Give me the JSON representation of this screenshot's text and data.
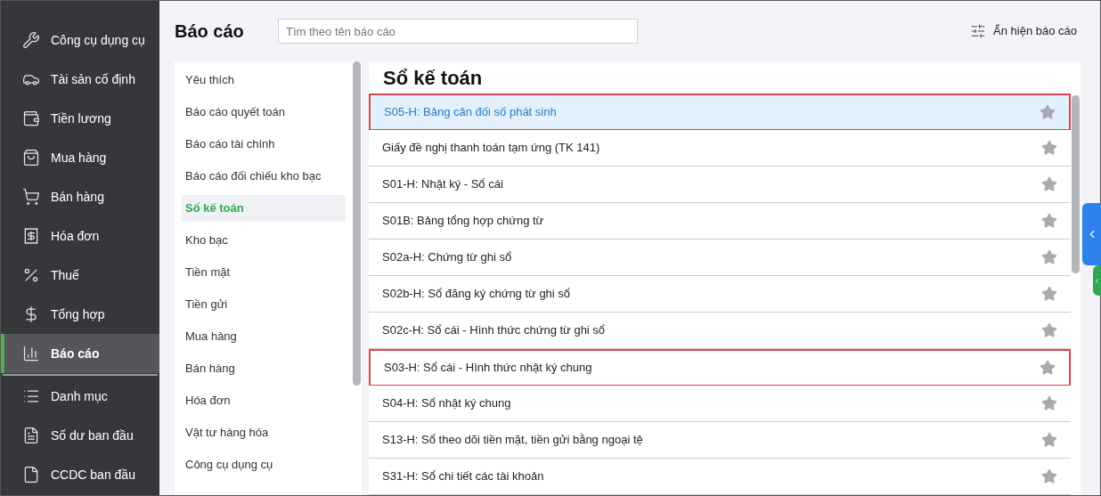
{
  "sidebar": {
    "items": [
      {
        "label": "Công cụ dụng cụ",
        "selected": false
      },
      {
        "label": "Tài sản cố định",
        "selected": false
      },
      {
        "label": "Tiền lương",
        "selected": false
      },
      {
        "label": "Mua hàng",
        "selected": false
      },
      {
        "label": "Bán hàng",
        "selected": false
      },
      {
        "label": "Hóa đơn",
        "selected": false
      },
      {
        "label": "Thuế",
        "selected": false
      },
      {
        "label": "Tổng hợp",
        "selected": false
      },
      {
        "label": "Báo cáo",
        "selected": true
      }
    ],
    "bottom_items": [
      {
        "label": "Danh mục",
        "selected": false
      },
      {
        "label": "Số dư ban đầu",
        "selected": false
      },
      {
        "label": "CCDC ban đầu",
        "selected": false
      }
    ]
  },
  "header": {
    "title": "Báo cáo",
    "search": {
      "placeholder": "Tìm theo tên báo cáo"
    },
    "toggle_button": "Ẩn hiện báo cáo"
  },
  "categories": [
    {
      "label": "Yêu thích",
      "selected": false
    },
    {
      "label": "Báo cáo quyết toán",
      "selected": false
    },
    {
      "label": "Báo cáo tài chính",
      "selected": false
    },
    {
      "label": "Báo cáo đối chiếu kho bạc",
      "selected": false
    },
    {
      "label": "Sổ kế toán",
      "selected": true
    },
    {
      "label": "Kho bạc",
      "selected": false
    },
    {
      "label": "Tiền mặt",
      "selected": false
    },
    {
      "label": "Tiền gửi",
      "selected": false
    },
    {
      "label": "Mua hàng",
      "selected": false
    },
    {
      "label": "Bán hàng",
      "selected": false
    },
    {
      "label": "Hóa đơn",
      "selected": false
    },
    {
      "label": "Vật tư hàng hóa",
      "selected": false
    },
    {
      "label": "Công cụ dụng cụ",
      "selected": false
    }
  ],
  "reports": {
    "title": "Sổ kế toán",
    "rows": [
      {
        "label": "S05-H: Bảng cân đối số phát sinh",
        "selected": true,
        "highlighted": true
      },
      {
        "label": "Giấy đề nghị thanh toán tạm ứng (TK 141)",
        "selected": false,
        "highlighted": false
      },
      {
        "label": "S01-H: Nhật ký - Sổ cái",
        "selected": false,
        "highlighted": false
      },
      {
        "label": "S01B: Bảng tổng hợp chứng từ",
        "selected": false,
        "highlighted": false
      },
      {
        "label": "S02a-H: Chứng từ ghi sổ",
        "selected": false,
        "highlighted": false
      },
      {
        "label": "S02b-H: Sổ đăng ký chứng từ ghi sổ",
        "selected": false,
        "highlighted": false
      },
      {
        "label": "S02c-H: Sổ cái - Hình thức chứng từ ghi sổ",
        "selected": false,
        "highlighted": false
      },
      {
        "label": "S03-H: Sổ cái - Hình thức nhật ký chung",
        "selected": false,
        "highlighted": true
      },
      {
        "label": "S04-H: Sổ nhật ký chung",
        "selected": false,
        "highlighted": false
      },
      {
        "label": "S13-H: Sổ theo dõi tiền mặt, tiền gửi bằng ngoại tệ",
        "selected": false,
        "highlighted": false
      },
      {
        "label": "S31-H: Sổ chi tiết các tài khoản",
        "selected": false,
        "highlighted": false
      }
    ]
  }
}
